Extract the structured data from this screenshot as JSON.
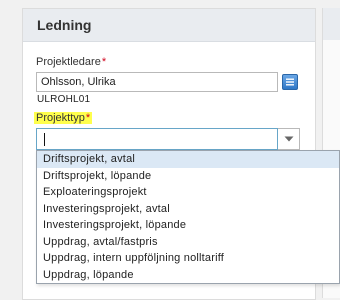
{
  "panel": {
    "title": "Ledning"
  },
  "projektledare": {
    "label": "Projektledare",
    "required_mark": "*",
    "value": "Ohlsson, Ulrika",
    "sub_value": "ULROHL01"
  },
  "projekttyp": {
    "label": "Projekttyp",
    "required_mark": "*",
    "value": "",
    "options": [
      "Driftsprojekt, avtal",
      "Driftsprojekt, löpande",
      "Exploateringsprojekt",
      "Investeringsprojekt, avtal",
      "Investeringsprojekt, löpande",
      "Uppdrag, avtal/fastpris",
      "Uppdrag, intern uppföljning nolltariff",
      "Uppdrag, löpande"
    ]
  },
  "icons": {
    "lookup": "lookup-icon",
    "dropdown": "chevron-down-icon"
  },
  "colors": {
    "highlight": "#ffff4d",
    "required": "#d0021b",
    "header_bg": "#e9ecf0",
    "focus_border": "#67a6c8",
    "option_hover": "#dbe8f5"
  }
}
